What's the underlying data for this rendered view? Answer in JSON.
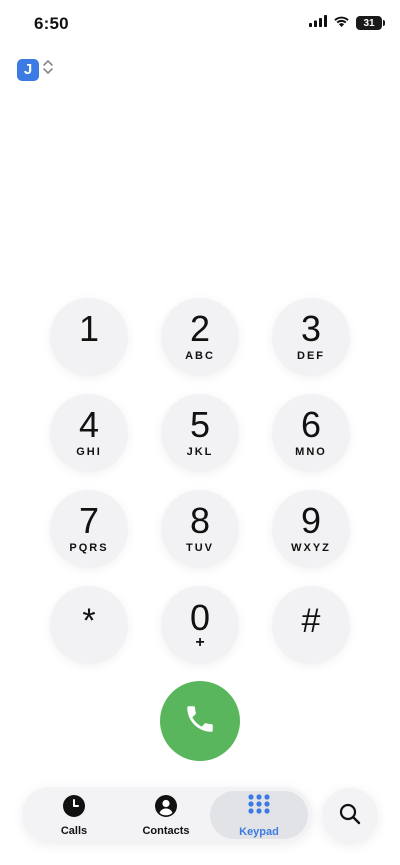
{
  "status_bar": {
    "time": "6:50",
    "battery_level": "31",
    "signal_icon": "cellular-signal-icon",
    "wifi_icon": "wifi-icon"
  },
  "account": {
    "initial": "J",
    "switch_icon": "chevron-up-down-icon",
    "accent_color": "#3b7be3"
  },
  "keypad": {
    "keys": [
      {
        "digit": "1",
        "letters": ""
      },
      {
        "digit": "2",
        "letters": "ABC"
      },
      {
        "digit": "3",
        "letters": "DEF"
      },
      {
        "digit": "4",
        "letters": "GHI"
      },
      {
        "digit": "5",
        "letters": "JKL"
      },
      {
        "digit": "6",
        "letters": "MNO"
      },
      {
        "digit": "7",
        "letters": "PQRS"
      },
      {
        "digit": "8",
        "letters": "TUV"
      },
      {
        "digit": "9",
        "letters": "WXYZ"
      },
      {
        "digit": "*",
        "letters": ""
      },
      {
        "digit": "0",
        "letters": "+"
      },
      {
        "digit": "#",
        "letters": ""
      }
    ],
    "call_icon": "phone-icon",
    "call_color": "#59b65c"
  },
  "tabs": [
    {
      "label": "Calls",
      "icon": "clock-icon",
      "active": false
    },
    {
      "label": "Contacts",
      "icon": "person-icon",
      "active": false
    },
    {
      "label": "Keypad",
      "icon": "keypad-grid-icon",
      "active": true
    }
  ],
  "search": {
    "icon": "search-icon"
  }
}
